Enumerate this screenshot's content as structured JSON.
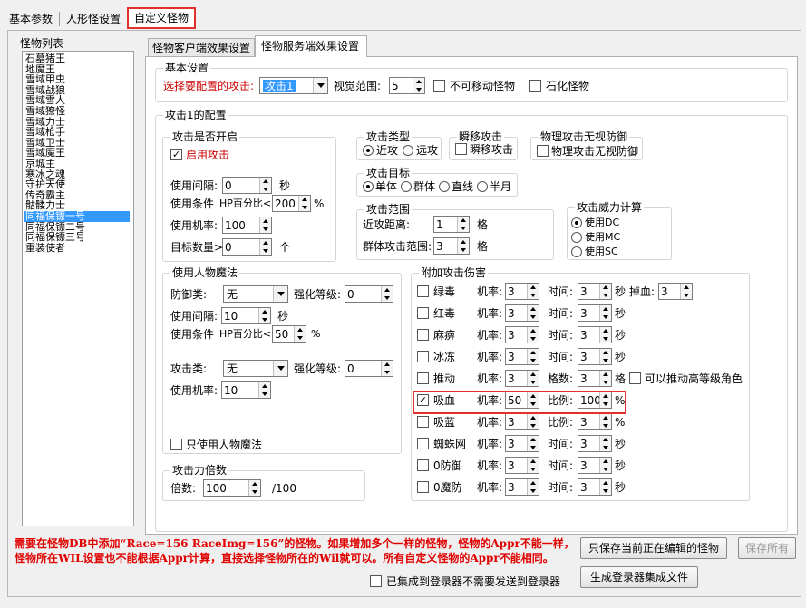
{
  "top_tabs": [
    "基本参数",
    "人形怪设置",
    "自定义怪物"
  ],
  "monster_list": {
    "title": "怪物列表",
    "items": [
      "石墓猪王",
      "地魔王",
      "雪域甲虫",
      "雪域战狼",
      "雪域雪人",
      "雪域獠怪",
      "雪域力士",
      "雪域枪手",
      "雪域卫士",
      "雪域魔王",
      "京城主",
      "寒冰之魂",
      "守护天使",
      "传奇霸主",
      "骷髅力士",
      "同福保镖一号",
      "同福保镖二号",
      "同福保镖三号",
      "重装使者"
    ],
    "selected": "同福保镖一号"
  },
  "sub_tabs": [
    "怪物客户端效果设置",
    "怪物服务端效果设置"
  ],
  "basic": {
    "title": "基本设置",
    "select_label": "选择要配置的攻击:",
    "attack_value": "攻击1",
    "vision_label": "视觉范围:",
    "vision_value": "5",
    "immovable_label": "不可移动怪物",
    "petrify_label": "石化怪物"
  },
  "config_title": "攻击1的配置",
  "open_group": {
    "title": "攻击是否开启",
    "enable_label": "启用攻击",
    "interval_label": "使用间隔:",
    "interval_value": "0",
    "interval_unit": "秒",
    "cond_label": "使用条件",
    "cond_hp": "HP百分比<",
    "cond_value": "200",
    "cond_unit": "%",
    "rate_label": "使用机率:",
    "rate_value": "100",
    "target_label": "目标数量>",
    "target_value": "0",
    "target_unit": "个"
  },
  "attack_type": {
    "title": "攻击类型",
    "opt1": "近攻",
    "opt2": "远攻"
  },
  "teleport": {
    "title": "瞬移攻击",
    "label": "瞬移攻击"
  },
  "phys": {
    "title": "物理攻击无视防御",
    "label": "物理攻击无视防御"
  },
  "target": {
    "title": "攻击目标",
    "opt1": "单体",
    "opt2": "群体",
    "opt3": "直线",
    "opt4": "半月"
  },
  "range": {
    "title": "攻击范围",
    "near_label": "近攻距离:",
    "near_value": "1",
    "near_unit": "格",
    "group_label": "群体攻击范围:",
    "group_value": "3",
    "group_unit": "格"
  },
  "power": {
    "title": "攻击威力计算",
    "opt1": "使用DC",
    "opt2": "使用MC",
    "opt3": "使用SC"
  },
  "magic": {
    "title": "使用人物魔法",
    "defense_label": "防御类:",
    "defense_value": "无",
    "level_label": "强化等级:",
    "level_value": "0",
    "interval_label": "使用间隔:",
    "interval_value": "10",
    "interval_unit": "秒",
    "cond_label": "使用条件",
    "cond_hp": "HP百分比<",
    "cond_value": "50",
    "cond_unit": "%",
    "attack_label": "攻击类:",
    "attack_value": "无",
    "level2_label": "强化等级:",
    "level2_value": "0",
    "rate_label": "使用机率:",
    "rate_value": "10",
    "only_label": "只使用人物魔法"
  },
  "multiplier": {
    "title": "攻击力倍数",
    "label": "倍数:",
    "value": "100",
    "unit": "/100"
  },
  "extra": {
    "title": "附加攻击伤害",
    "rows": [
      {
        "name": "绿毒",
        "checked": false,
        "rate_label": "机率:",
        "rate": "3",
        "second_label": "时间:",
        "second": "3",
        "unit": "秒",
        "extra_label": "掉血:",
        "extra_value": "3"
      },
      {
        "name": "红毒",
        "checked": false,
        "rate_label": "机率:",
        "rate": "3",
        "second_label": "时间:",
        "second": "3",
        "unit": "秒"
      },
      {
        "name": "麻痹",
        "checked": false,
        "rate_label": "机率:",
        "rate": "3",
        "second_label": "时间:",
        "second": "3",
        "unit": "秒"
      },
      {
        "name": "冰冻",
        "checked": false,
        "rate_label": "机率:",
        "rate": "3",
        "second_label": "时间:",
        "second": "3",
        "unit": "秒"
      },
      {
        "name": "推动",
        "checked": false,
        "rate_label": "机率:",
        "rate": "3",
        "second_label": "格数:",
        "second": "3",
        "unit": "格",
        "extra_label": "可以推动高等级角色"
      },
      {
        "name": "吸血",
        "checked": true,
        "rate_label": "机率:",
        "rate": "50",
        "second_label": "比例:",
        "second": "100",
        "unit": "%"
      },
      {
        "name": "吸蓝",
        "checked": false,
        "rate_label": "机率:",
        "rate": "3",
        "second_label": "比例:",
        "second": "3",
        "unit": "%"
      },
      {
        "name": "蜘蛛网",
        "checked": false,
        "rate_label": "机率:",
        "rate": "3",
        "second_label": "时间:",
        "second": "3",
        "unit": "秒"
      },
      {
        "name": "0防御",
        "checked": false,
        "rate_label": "机率:",
        "rate": "3",
        "second_label": "时间:",
        "second": "3",
        "unit": "秒"
      },
      {
        "name": "0魔防",
        "checked": false,
        "rate_label": "机率:",
        "rate": "3",
        "second_label": "时间:",
        "second": "3",
        "unit": "秒"
      }
    ]
  },
  "note": "需要在怪物DB中添加“Race=156 RaceImg=156”的怪物。如果增加多个一样的怪物，怪物的Appr不能一样，怪物所在WIL设置也不能根据Appr计算，直接选择怪物所在的Wil就可以。所有自定义怪物的Appr不能相同。",
  "buttons": {
    "save_current": "只保存当前正在编辑的怪物",
    "save_all": "保存所有",
    "generate": "生成登录器集成文件"
  },
  "integrated_label": "已集成到登录器不需要发送到登录器"
}
